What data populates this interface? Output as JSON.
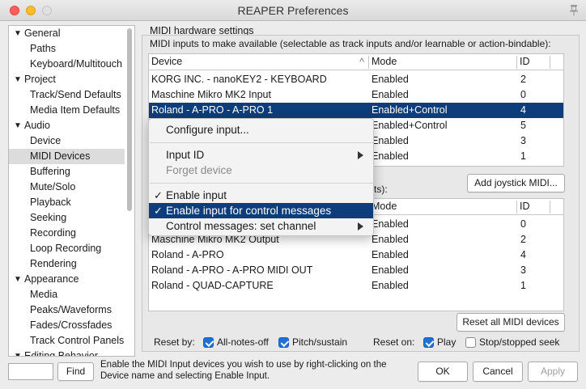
{
  "window": {
    "title": "REAPER Preferences"
  },
  "sidebar": {
    "items": [
      {
        "label": "General",
        "arrow": "▼"
      },
      {
        "label": "Paths"
      },
      {
        "label": "Keyboard/Multitouch"
      },
      {
        "label": "Project",
        "arrow": "▼"
      },
      {
        "label": "Track/Send Defaults"
      },
      {
        "label": "Media Item Defaults"
      },
      {
        "label": "Audio",
        "arrow": "▼"
      },
      {
        "label": "Device"
      },
      {
        "label": "MIDI Devices",
        "selected": true
      },
      {
        "label": "Buffering"
      },
      {
        "label": "Mute/Solo"
      },
      {
        "label": "Playback"
      },
      {
        "label": "Seeking"
      },
      {
        "label": "Recording"
      },
      {
        "label": "Loop Recording"
      },
      {
        "label": "Rendering"
      },
      {
        "label": "Appearance",
        "arrow": "▼"
      },
      {
        "label": "Media"
      },
      {
        "label": "Peaks/Waveforms"
      },
      {
        "label": "Fades/Crossfades"
      },
      {
        "label": "Track Control Panels"
      },
      {
        "label": "Editing Behavior",
        "arrow": "▼"
      }
    ]
  },
  "main": {
    "section_title": "MIDI hardware settings",
    "inputs_caption": "MIDI inputs to make available (selectable as track inputs and/or learnable or action-bindable):",
    "inputs_table": {
      "columns": [
        "Device",
        "Mode",
        "ID"
      ],
      "sort_arrow": "^",
      "rows": [
        {
          "device": "KORG INC. - nanoKEY2 - KEYBOARD",
          "mode": "Enabled",
          "id": "2"
        },
        {
          "device": "Maschine Mikro MK2 Input",
          "mode": "Enabled",
          "id": "0"
        },
        {
          "device": "Roland - A-PRO - A-PRO 1",
          "mode": "Enabled+Control",
          "id": "4",
          "selected": true
        },
        {
          "device": "",
          "mode": "Enabled+Control",
          "id": "5"
        },
        {
          "device": "",
          "mode": "Enabled",
          "id": "3"
        },
        {
          "device": "",
          "mode": "Enabled",
          "id": "1"
        }
      ]
    },
    "outputs_caption_fragment": "ts):",
    "add_joystick_label": "Add joystick MIDI...",
    "outputs_table": {
      "columns": [
        "Mode",
        "ID"
      ],
      "rows": [
        {
          "device": "",
          "mode": "Enabled",
          "id": "0"
        },
        {
          "device": "Maschine Mikro MK2 Output",
          "mode": "Enabled",
          "id": "2"
        },
        {
          "device": "Roland - A-PRO",
          "mode": "Enabled",
          "id": "4"
        },
        {
          "device": "Roland - A-PRO - A-PRO MIDI OUT",
          "mode": "Enabled",
          "id": "3"
        },
        {
          "device": "Roland - QUAD-CAPTURE",
          "mode": "Enabled",
          "id": "1"
        }
      ]
    },
    "reset_all_label": "Reset all MIDI devices",
    "reset_by_label": "Reset by:",
    "all_notes_off_label": "All-notes-off",
    "pitch_sustain_label": "Pitch/sustain",
    "reset_on_label": "Reset on:",
    "play_label": "Play",
    "stop_seek_label": "Stop/stopped seek",
    "checks": {
      "all_notes_off": true,
      "pitch_sustain": true,
      "play": true,
      "stop_seek": false
    }
  },
  "context_menu": {
    "configure": "Configure input...",
    "input_id": "Input ID",
    "forget": "Forget device",
    "enable_input": "Enable input",
    "enable_control": "Enable input for control messages",
    "set_channel": "Control messages: set channel",
    "checkmark": "✓"
  },
  "footer": {
    "find_label": "Find",
    "help_text": "Enable the MIDI Input devices you wish to use by right-clicking on the Device name and selecting Enable Input.",
    "ok_label": "OK",
    "cancel_label": "Cancel",
    "apply_label": "Apply"
  },
  "colors": {
    "selection": "#0d3d7a",
    "checkbox": "#1f6fd6"
  }
}
